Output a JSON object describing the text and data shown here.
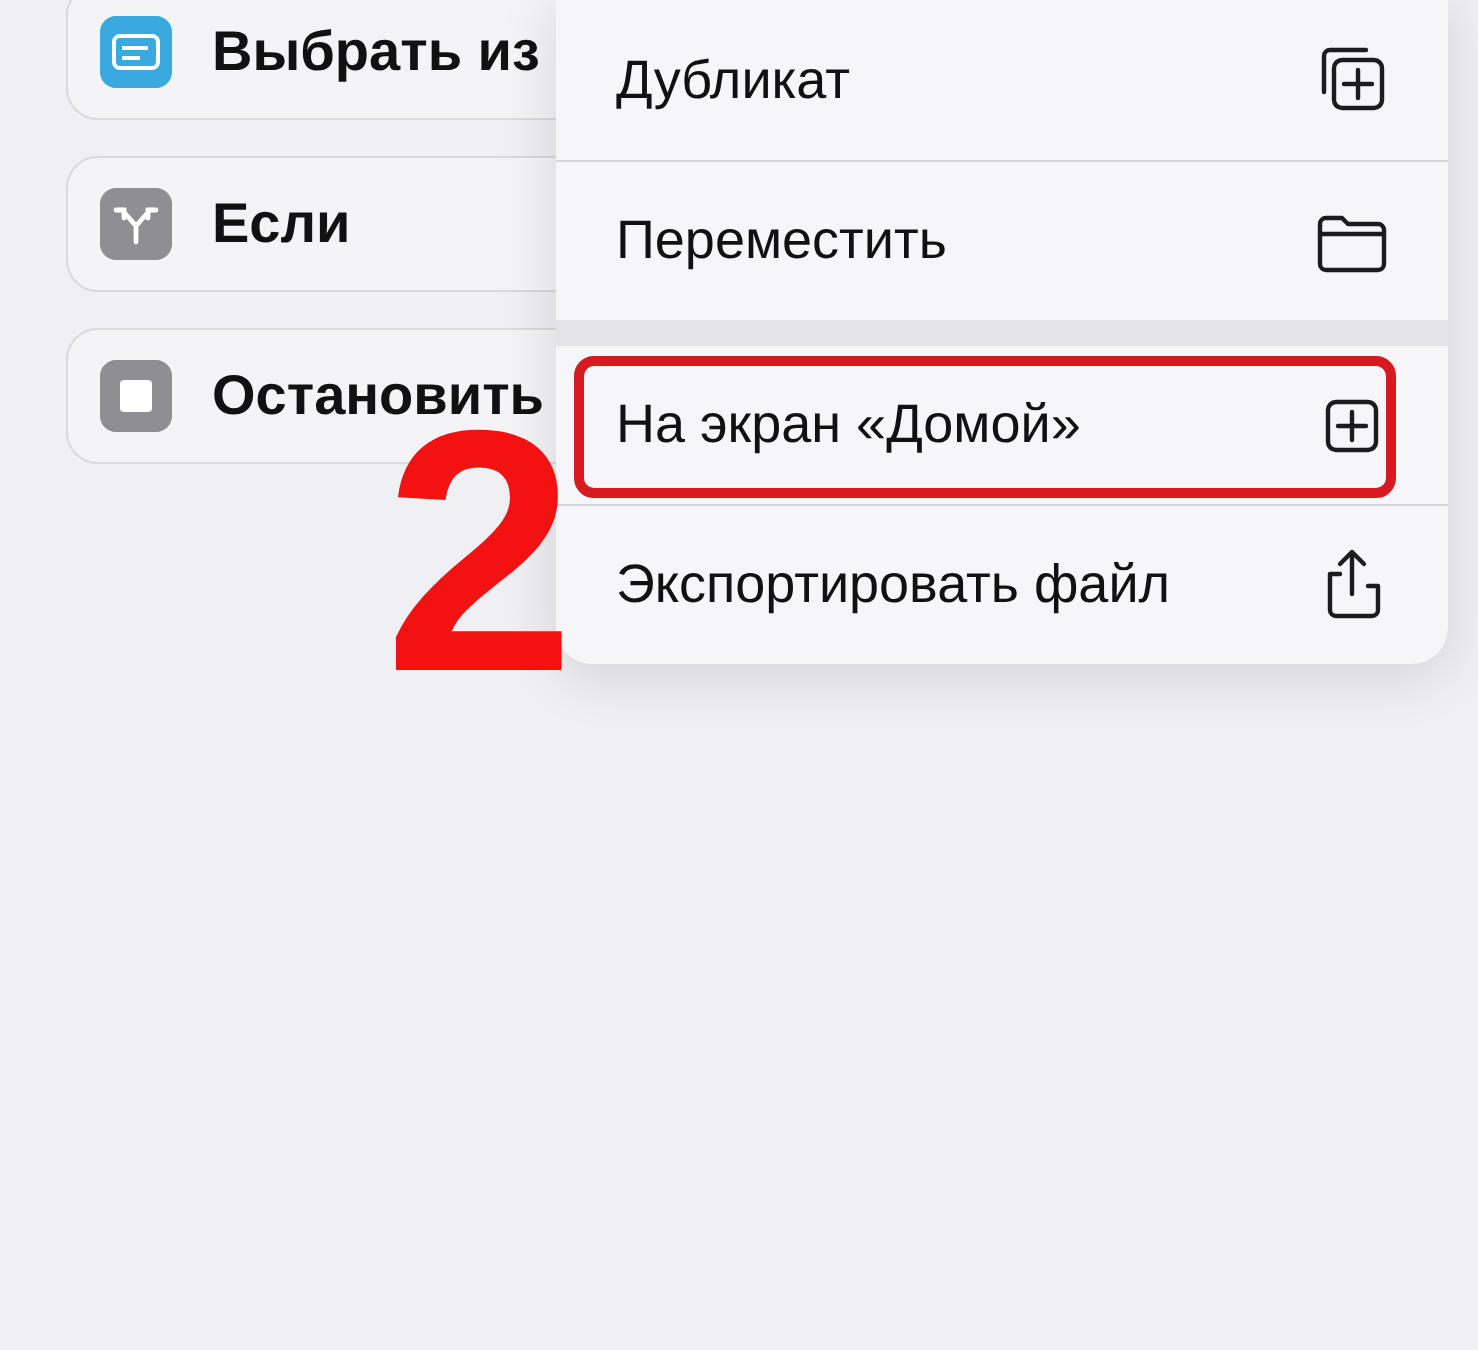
{
  "actions": [
    {
      "label": "Выбрать из",
      "kind": "list",
      "color": "#3aa9df"
    },
    {
      "label": "Если",
      "kind": "branch",
      "color": "#8e8e93"
    },
    {
      "label": "Остановить",
      "kind": "stop",
      "color": "#8e8e93"
    }
  ],
  "menu": {
    "groups": [
      [
        {
          "label": "Дубликат",
          "kind": "duplicate",
          "highlighted": false
        },
        {
          "label": "Переместить",
          "kind": "folder",
          "highlighted": false
        }
      ],
      [
        {
          "label": "На экран «Домой»",
          "kind": "add",
          "highlighted": true
        },
        {
          "label": "Экспортировать файл",
          "kind": "share",
          "highlighted": false
        }
      ]
    ]
  },
  "annotation": {
    "text": "2"
  }
}
